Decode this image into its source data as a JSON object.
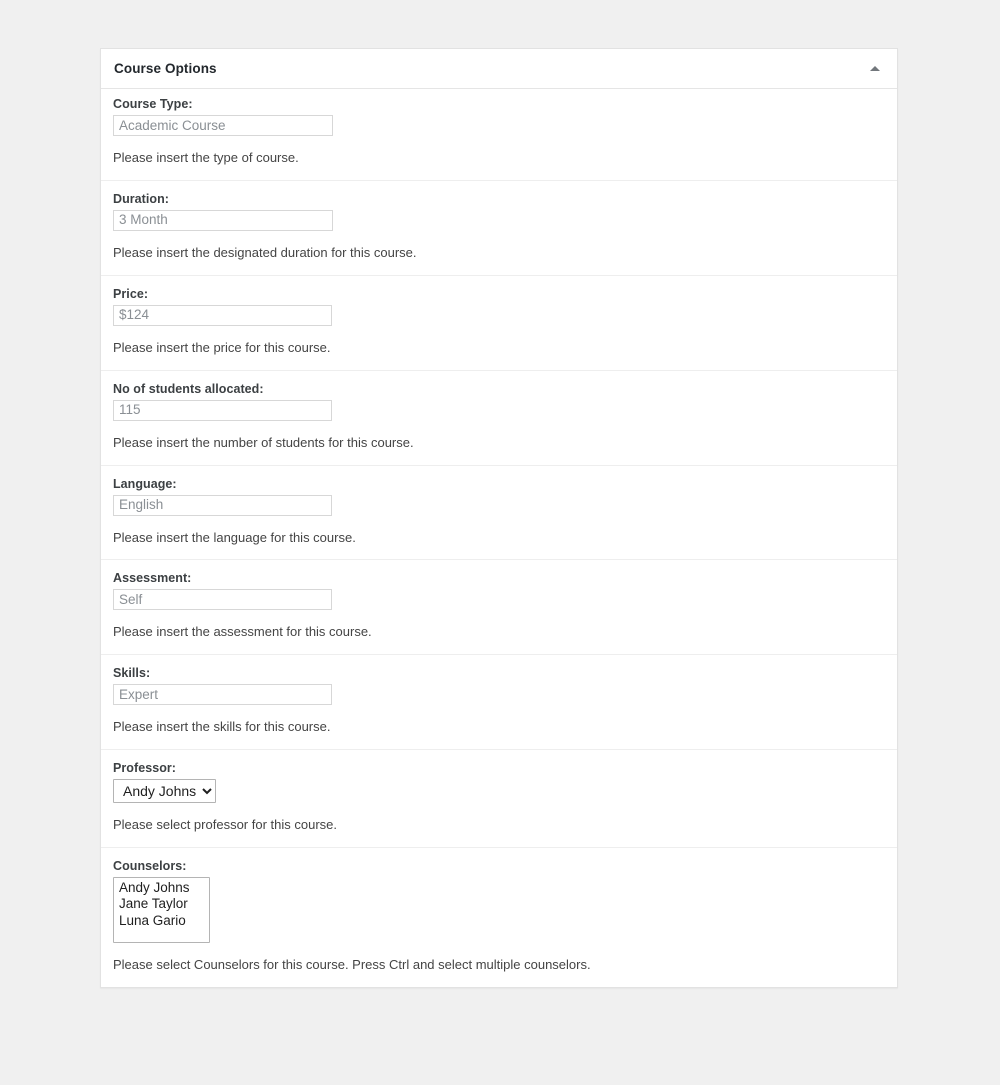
{
  "card": {
    "title": "Course Options",
    "collapse_icon": "caret-up-icon"
  },
  "fields": [
    {
      "label": "Course Type:",
      "value": "Academic Course",
      "help": "Please insert the type of course."
    },
    {
      "label": "Duration:",
      "value": "3 Month",
      "help": "Please insert the designated duration for this course."
    },
    {
      "label": "Price:",
      "value": "$124",
      "help": "Please insert the price for this course."
    },
    {
      "label": "No of students allocated:",
      "value": "115",
      "help": "Please insert the number of students for this course."
    },
    {
      "label": "Language:",
      "value": "English",
      "help": "Please insert the language for this course."
    },
    {
      "label": "Assessment:",
      "value": "Self",
      "help": "Please insert the assessment for this course."
    },
    {
      "label": "Skills:",
      "value": "Expert",
      "help": "Please insert the skills for this course."
    }
  ],
  "professor": {
    "label": "Professor:",
    "selected": "Andy Johns",
    "options": [
      "Andy Johns"
    ],
    "help": "Please select professor for this course."
  },
  "counselors": {
    "label": "Counselors:",
    "options": [
      "Andy Johns",
      "Jane Taylor",
      "Luna Gario"
    ],
    "help": "Please select Counselors for this course. Press Ctrl and select multiple counselors."
  },
  "colors": {
    "page_background": "#f0f0f0",
    "card_background": "#ffffff",
    "card_border": "#e2e2e2",
    "divider": "#eeeeee",
    "label_text": "#3c4043",
    "input_text": "#8a8f94",
    "help_text": "#444444",
    "caret": "#72777c"
  }
}
